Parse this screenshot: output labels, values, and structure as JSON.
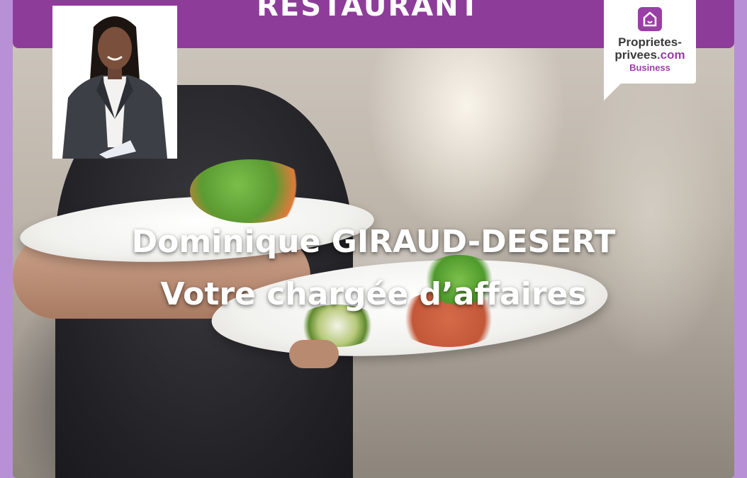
{
  "banner": {
    "title": "RESTAURANT",
    "color": "#8e3c99"
  },
  "logo": {
    "icon": "home-bubble-icon",
    "line1": "Proprietes-",
    "line2_prefix": "privees",
    "line2_suffix": ".com",
    "line3": "Business",
    "brand_color": "#9a3fa6",
    "text_color": "#3a3a3a"
  },
  "agent": {
    "photo_icon": "agent-portrait",
    "name": "Dominique GIRAUD-DESERT",
    "role": "Votre chargée d’affaires"
  },
  "background": {
    "scene": "waiter-carrying-plates-photo"
  }
}
